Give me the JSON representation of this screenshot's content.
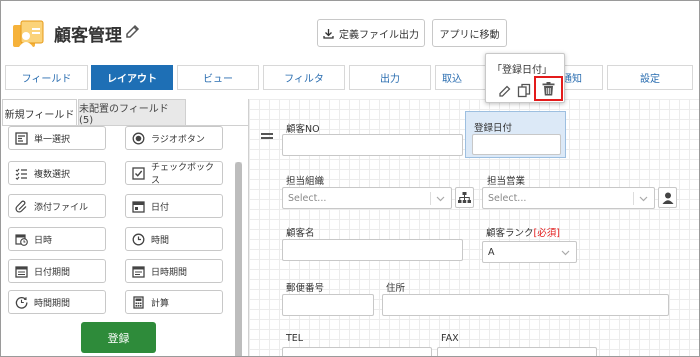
{
  "app": {
    "title": "顧客管理"
  },
  "header": {
    "export_label": "定義ファイル出力",
    "goto_label": "アプリに移動"
  },
  "tabs": [
    {
      "label": "フィールド",
      "active": false
    },
    {
      "label": "レイアウト",
      "active": true
    },
    {
      "label": "ビュー",
      "active": false
    },
    {
      "label": "フィルタ",
      "active": false
    },
    {
      "label": "出力",
      "active": false
    },
    {
      "label": "取込",
      "active": false
    },
    {
      "label": "通知",
      "active": false
    },
    {
      "label": "設定",
      "active": false
    }
  ],
  "popup": {
    "title": "「登録日付」",
    "actions": [
      "edit-icon",
      "copy-icon",
      "trash-icon"
    ]
  },
  "left_tabs": {
    "new_fields": "新規フィールド",
    "unplaced_fields": "未配置のフィールド (5)"
  },
  "field_types": [
    {
      "label": "単一選択",
      "icon": "single-select-icon"
    },
    {
      "label": "ラジオボタン",
      "icon": "radio-icon"
    },
    {
      "label": "複数選択",
      "icon": "multi-select-icon"
    },
    {
      "label": "チェックボックス",
      "icon": "checkbox-icon"
    },
    {
      "label": "添付ファイル",
      "icon": "paperclip-icon"
    },
    {
      "label": "日付",
      "icon": "calendar-icon"
    },
    {
      "label": "日時",
      "icon": "calendar-clock-icon"
    },
    {
      "label": "時間",
      "icon": "clock-icon"
    },
    {
      "label": "日付期間",
      "icon": "date-range-icon"
    },
    {
      "label": "日時期間",
      "icon": "datetime-range-icon"
    },
    {
      "label": "時間期間",
      "icon": "time-range-icon"
    },
    {
      "label": "計算",
      "icon": "calculator-icon"
    }
  ],
  "register_label": "登録",
  "form": {
    "customer_no": "顧客NO",
    "reg_date": "登録日付",
    "org": "担当組織",
    "sales": "担当営業",
    "select_placeholder": "Select...",
    "customer_name": "顧客名",
    "customer_rank": "顧客ランク",
    "required": "[必須]",
    "rank_value": "A",
    "postal": "郵便番号",
    "address": "住所",
    "tel": "TEL",
    "fax": "FAX"
  },
  "colors": {
    "accent": "#1e6fb5",
    "register": "#2e8b3a",
    "highlight": "#e31b1b",
    "selected_field": "#dce9f7"
  }
}
